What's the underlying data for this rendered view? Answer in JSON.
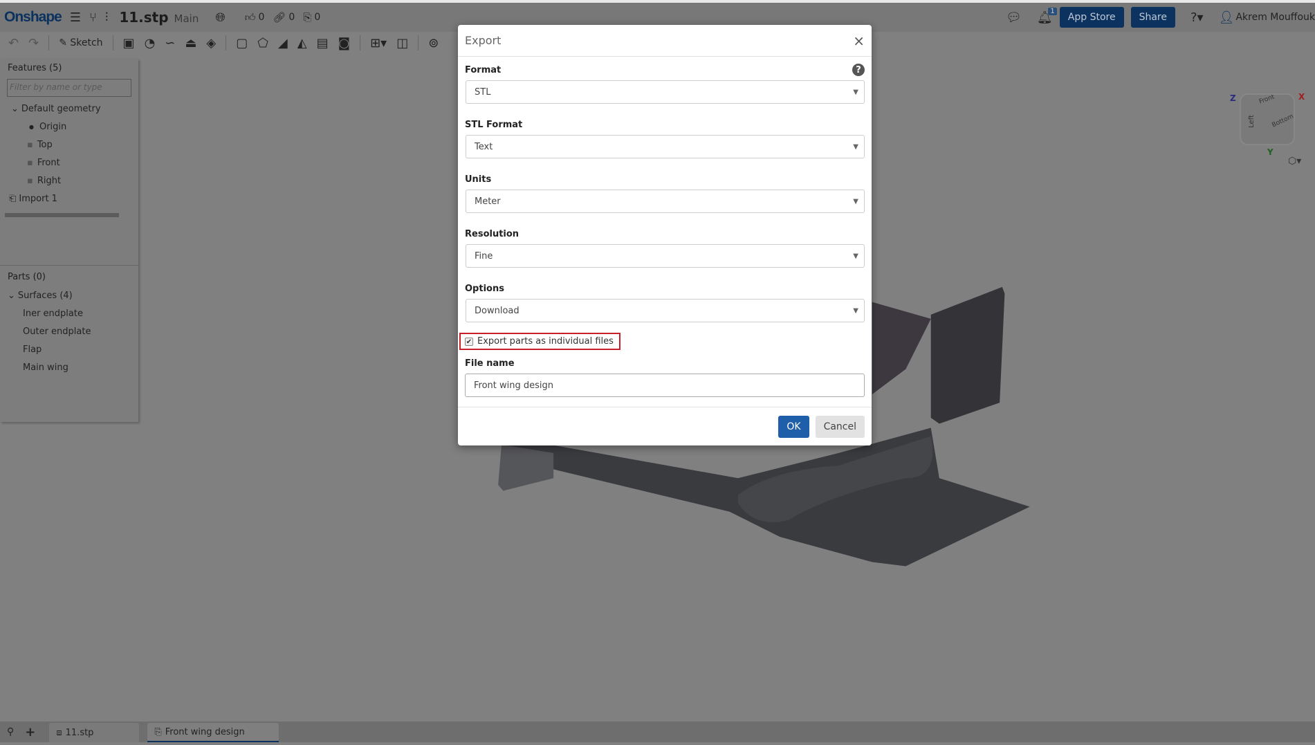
{
  "app": {
    "logo": "Onshape",
    "doc_title": "11.stp",
    "branch": "Main",
    "likes": "0",
    "links": "0",
    "copies": "0"
  },
  "header": {
    "notifications": "1",
    "app_store": "App Store",
    "share": "Share",
    "user": "Akrem Mouffouk"
  },
  "toolbar": {
    "sketch": "Sketch"
  },
  "features": {
    "title": "Features (5)",
    "filter_placeholder": "Filter by name or type",
    "group": "Default geometry",
    "items": [
      "Origin",
      "Top",
      "Front",
      "Right"
    ],
    "import": "Import 1"
  },
  "parts": {
    "title": "Parts (0)",
    "group": "Surfaces (4)",
    "items": [
      "Iner endplate",
      "Outer endplate",
      "Flap",
      "Main wing"
    ]
  },
  "viewcube": {
    "top": "Front",
    "left": "Left",
    "right": "Bottom",
    "x": "X",
    "y": "Y",
    "z": "Z"
  },
  "tabs": [
    {
      "label": "11.stp"
    },
    {
      "label": "Front wing design"
    }
  ],
  "dialog": {
    "title": "Export",
    "fields": {
      "format": {
        "label": "Format",
        "value": "STL"
      },
      "stl_format": {
        "label": "STL Format",
        "value": "Text"
      },
      "units": {
        "label": "Units",
        "value": "Meter"
      },
      "resolution": {
        "label": "Resolution",
        "value": "Fine"
      },
      "options": {
        "label": "Options",
        "value": "Download"
      }
    },
    "checkbox_label": "Export parts as individual files",
    "checkbox_checked": true,
    "file_name_label": "File name",
    "file_name_value": "Front wing design",
    "ok": "OK",
    "cancel": "Cancel"
  },
  "colors": {
    "brand": "#0c3260",
    "ok": "#1f5fa9",
    "highlight": "#c8202a"
  }
}
